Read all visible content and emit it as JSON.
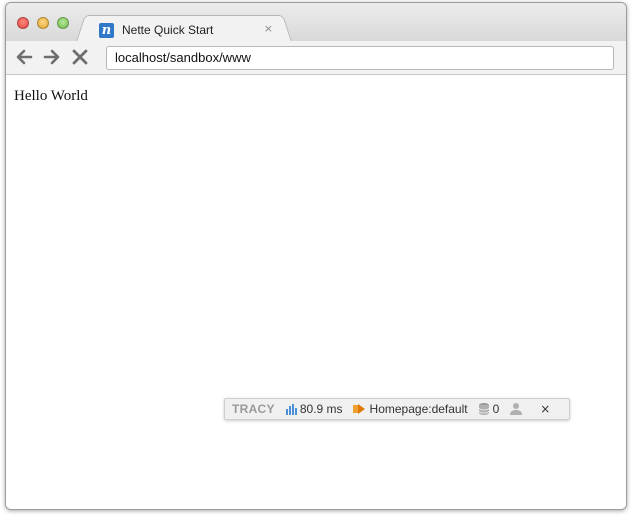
{
  "browser": {
    "tab": {
      "title": "Nette Quick Start",
      "favicon_letter": "n",
      "close_glyph": "×"
    },
    "nav": {
      "back_glyph": "🡐",
      "forward_glyph": "🡒",
      "stop_glyph": "✕"
    },
    "url": "localhost/sandbox/www"
  },
  "page": {
    "body_text": "Hello World"
  },
  "tracy": {
    "logo": "TRACY",
    "time": "80.9 ms",
    "presenter": "Homepage:default",
    "db_queries": "0",
    "close_glyph": "×",
    "colors": {
      "time_icon": "#4a90d9",
      "presenter_icon": "#e07b00",
      "db_icon": "#9a9a9a",
      "user_icon": "#b0b0b0"
    }
  }
}
